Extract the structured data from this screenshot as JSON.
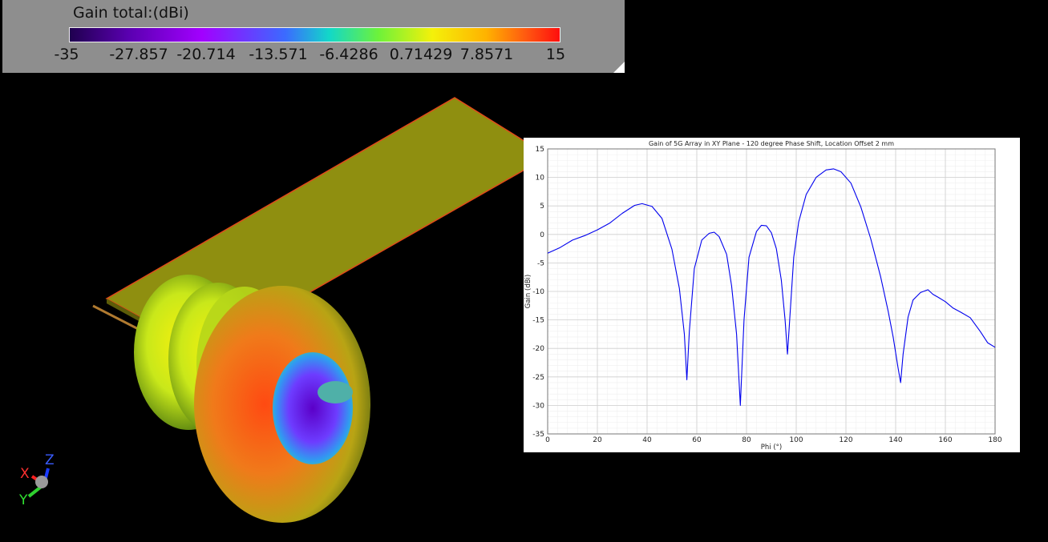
{
  "legend": {
    "title": "Gain total:(dBi)",
    "ticks": [
      "-35",
      "-27.857",
      "-20.714",
      "-13.571",
      "-6.4286",
      "0.71429",
      "7.8571",
      "15"
    ],
    "colors": [
      "#1f004f",
      "#a200ff",
      "#3b6bff",
      "#6df23a",
      "#f4f10a",
      "#ff5a10",
      "#ff0e0e"
    ]
  },
  "axes_triad": {
    "labels": [
      "X",
      "Y",
      "Z"
    ]
  },
  "chart_data": {
    "type": "line",
    "title": "Gain of 5G Array in XY Plane - 120 degree Phase Shift, Location Offset 2 mm",
    "xlabel": "Phi (°)",
    "ylabel": "Gain (dBi)",
    "xlim": [
      0,
      180
    ],
    "ylim": [
      -35,
      15
    ],
    "xticks": [
      0,
      20,
      40,
      60,
      80,
      100,
      120,
      140,
      160,
      180
    ],
    "yticks": [
      15,
      10,
      5,
      0,
      -5,
      -10,
      -15,
      -20,
      -25,
      -30,
      -35
    ],
    "grid": true,
    "series": [
      {
        "color": "#0000ee",
        "x": [
          0,
          5,
          10,
          15,
          20,
          25,
          30,
          35,
          38,
          42,
          46,
          50,
          53,
          55,
          56,
          57,
          59,
          62,
          65,
          67,
          69,
          72,
          74,
          76,
          77.5,
          79,
          81,
          84,
          86,
          88,
          90,
          92,
          94,
          95.5,
          96.5,
          97.5,
          99,
          101,
          104,
          108,
          112,
          115,
          118,
          122,
          126,
          130,
          134,
          137,
          139,
          141,
          142,
          143,
          145,
          147,
          150,
          153,
          155,
          157,
          160,
          163,
          166,
          170,
          174,
          177,
          180
        ],
        "y": [
          -3.3,
          -2.3,
          -1.0,
          -0.2,
          0.8,
          2.0,
          3.7,
          5.1,
          5.4,
          4.9,
          2.8,
          -2.6,
          -9.5,
          -17.5,
          -25.5,
          -17.0,
          -6.0,
          -1.0,
          0.2,
          0.4,
          -0.4,
          -3.5,
          -9.0,
          -17.5,
          -30.0,
          -15.0,
          -4.0,
          0.5,
          1.6,
          1.5,
          0.3,
          -2.5,
          -8.0,
          -15.0,
          -21.0,
          -14.0,
          -4.0,
          2.2,
          7.0,
          10.0,
          11.3,
          11.5,
          11.0,
          9.0,
          4.8,
          -0.8,
          -7.5,
          -13.5,
          -18.0,
          -23.5,
          -26.0,
          -21.0,
          -14.5,
          -11.5,
          -10.2,
          -9.7,
          -10.5,
          -11.0,
          -11.8,
          -12.9,
          -13.6,
          -14.6,
          -17.0,
          -19.0,
          -19.8
        ]
      }
    ]
  }
}
